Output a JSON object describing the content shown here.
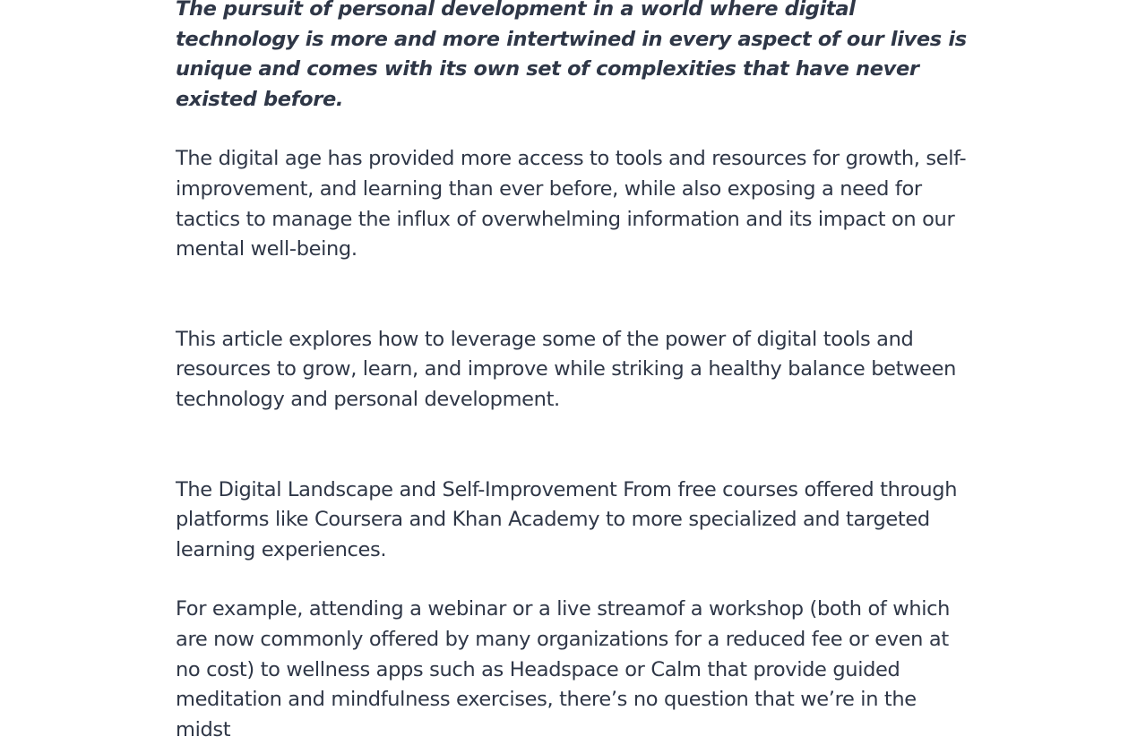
{
  "article": {
    "intro": "The pursuit of personal development in a world where digital technology is more and more intertwined in every aspect of our lives is unique and comes with its own set of complexities that have never existed before.",
    "paragraphs": [
      "The digital age has provided more access to tools and resources for growth, self-improvement, and learning than ever before, while also exposing a need for tactics to manage the influx of overwhelming information and its impact on our mental well-being.",
      "This article explores how to leverage some of the power of digital tools and resources to grow, learn, and improve while striking a healthy balance between technology and personal development.",
      "The Digital Landscape and Self-Improvement From free courses offered through platforms like Coursera and Khan Academy to more specialized and targeted learning experiences.",
      "For example, attending a webinar or a live streamof a workshop (both of which are now commonly offered by many organizations for a reduced fee or even at no cost) to wellness apps such as Headspace or Calm that provide guided meditation and mindfulness exercises, there’s no question that we’re in the midst"
    ]
  }
}
